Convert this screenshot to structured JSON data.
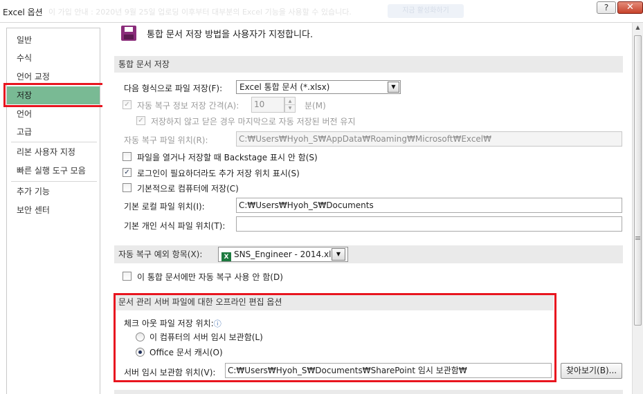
{
  "window": {
    "title": "Excel 옵션",
    "help_glyph": "?",
    "close_glyph": "✕",
    "ghost_text": "이 가입 안내 : 2020년 9월 25일 업로딩 이후부터 대부분의 Excel 기능을 사용할 수 있습니다.",
    "ghost_button": "지금 활성화하기"
  },
  "sidebar": {
    "items": [
      "일반",
      "수식",
      "언어 교정",
      "저장",
      "언어",
      "고급",
      "리본 사용자 지정",
      "빠른 실행 도구 모음",
      "추가 기능",
      "보안 센터"
    ],
    "selected": "저장"
  },
  "header": {
    "text": "통합 문서 저장 방법을 사용자가 지정합니다."
  },
  "save_section": {
    "title": "통합 문서 저장",
    "format_label": "다음 형식으로 파일 저장(F):",
    "format_value": "Excel 통합 문서 (*.xlsx)",
    "autorecover_label": "자동 복구 정보 저장 간격(A):",
    "autorecover_checked": true,
    "autorecover_minutes": "10",
    "minutes_unit": "분(M)",
    "keep_last_label": "저장하지 않고 닫은 경우 마지막으로 자동 저장된 버전 유지",
    "keep_last_checked": true,
    "autorecover_location_label": "자동 복구 파일 위치(R):",
    "autorecover_location_value": "C:₩Users₩Hyoh_S₩AppData₩Roaming₩Microsoft₩Excel₩",
    "no_backstage_label": "파일을 열거나 저장할 때 Backstage 표시 안 함(S)",
    "no_backstage_checked": false,
    "show_additional_label": "로그인이 필요하더라도 추가 저장 위치 표시(S)",
    "show_additional_checked": true,
    "save_to_computer_label": "기본적으로 컴퓨터에 저장(C)",
    "save_to_computer_checked": false,
    "local_location_label": "기본 로컬 파일 위치(I):",
    "local_location_value": "C:₩Users₩Hyoh_S₩Documents",
    "template_location_label": "기본 개인 서식 파일 위치(T):",
    "template_location_value": ""
  },
  "autorecover_exceptions": {
    "title": "자동 복구 예외 항목(X):",
    "workbook_value": "SNS_Engineer - 2014.xl...",
    "workbook_icon": "X",
    "disable_label": "이 통합 문서에만 자동 복구 사용 안 함(D)",
    "disable_checked": false
  },
  "offline_section": {
    "title": "문서 관리 서버 파일에 대한 오프라인 편집 옵션",
    "checkout_label": "체크 아웃 파일 저장 위치:",
    "info_glyph": "ⓘ",
    "radio_server_label": "이 컴퓨터의 서버 임시 보관함(L)",
    "radio_cache_label": "Office 문서 캐시(O)",
    "selected_option": "Office 문서 캐시(O)",
    "server_drafts_label": "서버 임시 보관함 위치(V):",
    "server_drafts_value": "C:₩Users₩Hyoh_S₩Documents₩SharePoint 임시 보관함₩",
    "browse_label": "찾아보기(B)..."
  },
  "icons": {
    "dropdown": "▼",
    "spin_up": "▲",
    "spin_down": "▼",
    "check": "✓",
    "scroll_up": "▲"
  },
  "colors": {
    "selected_item": "#79ba94",
    "highlight_box": "#e8151f",
    "section_header": "#eaeaea"
  }
}
